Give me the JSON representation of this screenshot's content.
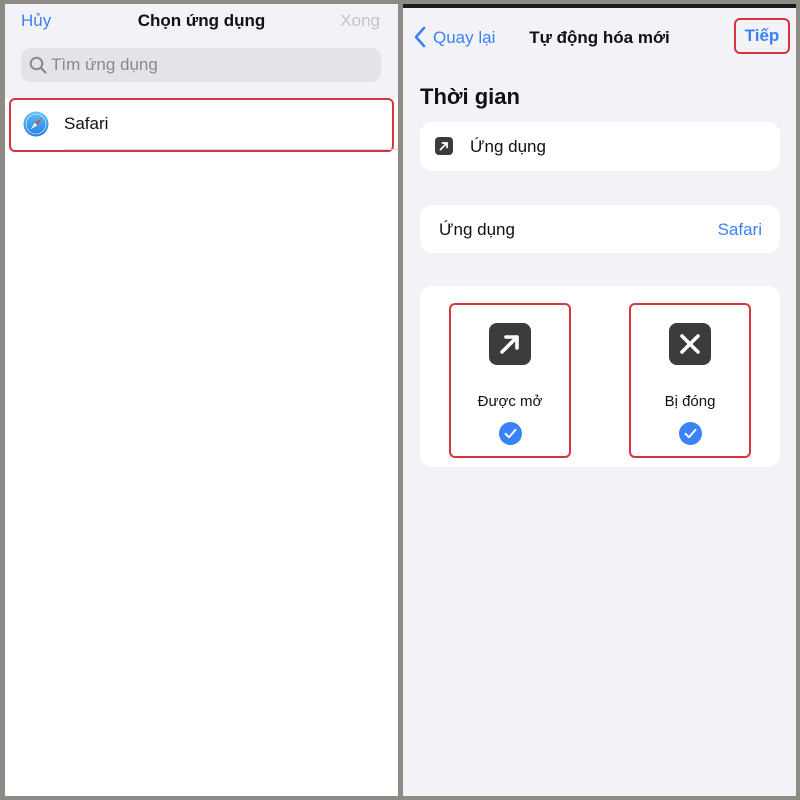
{
  "left": {
    "header": {
      "cancel_label": "Hủy",
      "title": "Chọn ứng dụng",
      "done_label": "Xong"
    },
    "search": {
      "placeholder": "Tìm ứng dụng",
      "icon": "search-icon"
    },
    "apps": [
      {
        "name": "Safari",
        "icon": "safari-icon"
      }
    ]
  },
  "right": {
    "header": {
      "back_label": "Quay lại",
      "title": "Tự động hóa mới",
      "next_label": "Tiếp"
    },
    "section_title": "Thời gian",
    "trigger_card": {
      "label": "Ứng dụng",
      "icon": "arrow-up-right-icon"
    },
    "app_card": {
      "label": "Ứng dụng",
      "value": "Safari"
    },
    "options": [
      {
        "label": "Được mở",
        "icon": "arrow-up-right-icon",
        "checked": true
      },
      {
        "label": "Bị đóng",
        "icon": "close-icon",
        "checked": true
      }
    ]
  },
  "colors": {
    "accent": "#3a82f7",
    "highlight": "#d8343e",
    "icon_tile": "#3b3b3d",
    "background": "#f2f2f7"
  }
}
